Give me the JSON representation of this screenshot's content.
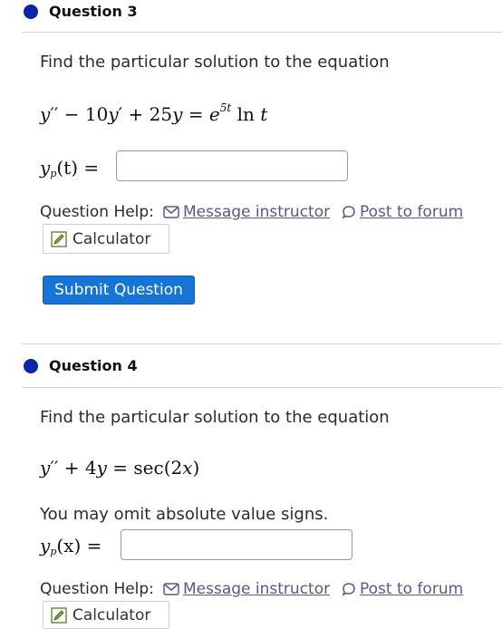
{
  "q3": {
    "title": "Question 3",
    "prompt": "Find the particular solution to the equation",
    "equation": {
      "y": "y",
      "primes1": "′′",
      "t1": " − 10",
      "y2": "y",
      "primes2": "′",
      "t2": " + 25",
      "y3": "y",
      "t3": " = ",
      "e": "e",
      "exp": "5t",
      "ln": " ln ",
      "t": "t"
    },
    "answer": {
      "y": "y",
      "sub": "p",
      "arg": "(t) =",
      "value": ""
    },
    "help_label": "Question Help:",
    "message_link": "Message instructor",
    "forum_link": "Post to forum",
    "calculator_label": "Calculator",
    "submit_label": "Submit Question"
  },
  "q4": {
    "title": "Question 4",
    "prompt": "Find the particular solution to the equation",
    "equation": {
      "y": "y",
      "primes1": "′′",
      "t1": " + 4",
      "y2": "y",
      "t2": " = ",
      "sec": "sec(2",
      "x": "x",
      "close": ")"
    },
    "note": "You may omit absolute value signs.",
    "answer": {
      "y": "y",
      "sub": "p",
      "arg": "(x) =",
      "value": ""
    },
    "help_label": "Question Help:",
    "message_link": "Message instructor",
    "forum_link": "Post to forum",
    "calculator_label": "Calculator"
  },
  "colors": {
    "dot": "#0b24a8",
    "submit": "#1674d6",
    "link": "#555a88"
  },
  "icons": [
    "envelope-icon",
    "speech-bubble-icon",
    "pencil-icon"
  ]
}
